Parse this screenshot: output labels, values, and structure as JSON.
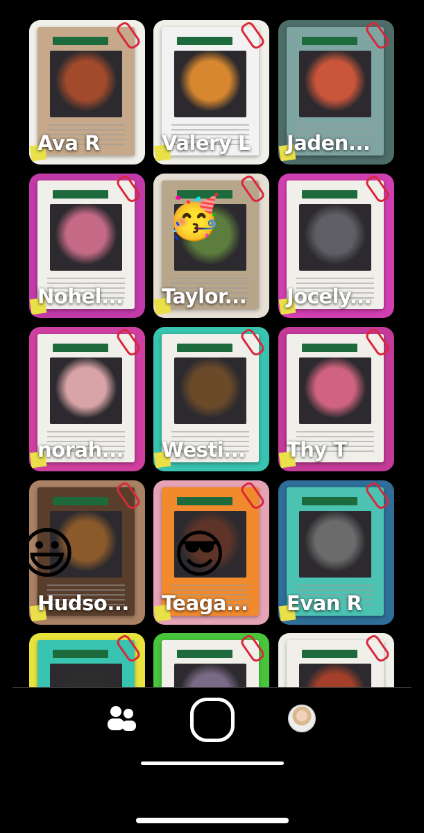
{
  "participants": [
    {
      "name": "Ava R",
      "bg": "#f1efe9",
      "accent": "#c5a98a",
      "art": "#a14a2c",
      "emoji": ""
    },
    {
      "name": "Valery L",
      "bg": "#f1efe9",
      "accent": "#f2f2f2",
      "art": "#d7872f",
      "emoji": ""
    },
    {
      "name": "Jaden...",
      "bg": "#4d6d6a",
      "accent": "#7fa5a2",
      "art": "#c9553b",
      "emoji": ""
    },
    {
      "name": "Nohel...",
      "bg": "#c23aa8",
      "accent": "#f1efe9",
      "art": "#c46a86",
      "emoji": ""
    },
    {
      "name": "Taylor...",
      "bg": "#e6dfd4",
      "accent": "#b8a68b",
      "art": "#5d7d3e",
      "emoji": "🥳"
    },
    {
      "name": "Jocely...",
      "bg": "#d03fb0",
      "accent": "#f1efe9",
      "art": "#5f5e64",
      "emoji": ""
    },
    {
      "name": "norah...",
      "bg": "#cf3f9f",
      "accent": "#f1efe9",
      "art": "#d9a4a8",
      "emoji": ""
    },
    {
      "name": "Westi...",
      "bg": "#38c4b0",
      "accent": "#f1efe9",
      "art": "#6b4a2a",
      "emoji": ""
    },
    {
      "name": "Thy T",
      "bg": "#c43a99",
      "accent": "#f1efe9",
      "art": "#d0637f",
      "emoji": ""
    },
    {
      "name": "Hudso...",
      "bg": "#a98164",
      "accent": "#5a3e2c",
      "art": "#8b5a2b",
      "emoji": "😃"
    },
    {
      "name": "Teaga...",
      "bg": "#e6a3b6",
      "accent": "#f08a2c",
      "art": "#5e3428",
      "emoji": "😎"
    },
    {
      "name": "Evan R",
      "bg": "#2f6e99",
      "accent": "#4cc3b2",
      "art": "#6b6b6b",
      "emoji": ""
    },
    {
      "name": "",
      "bg": "#e8e43d",
      "accent": "#38c4b0",
      "art": "#2d2d2d",
      "emoji": ""
    },
    {
      "name": "",
      "bg": "#49c53d",
      "accent": "#f1efe9",
      "art": "#7b6a86",
      "emoji": ""
    },
    {
      "name": "",
      "bg": "#f1efe9",
      "accent": "#f1efe9",
      "art": "#a4402a",
      "emoji": ""
    }
  ],
  "nav": {
    "people_icon": "people-icon",
    "capture_icon": "capture-button",
    "avatar_icon": "profile-avatar"
  }
}
